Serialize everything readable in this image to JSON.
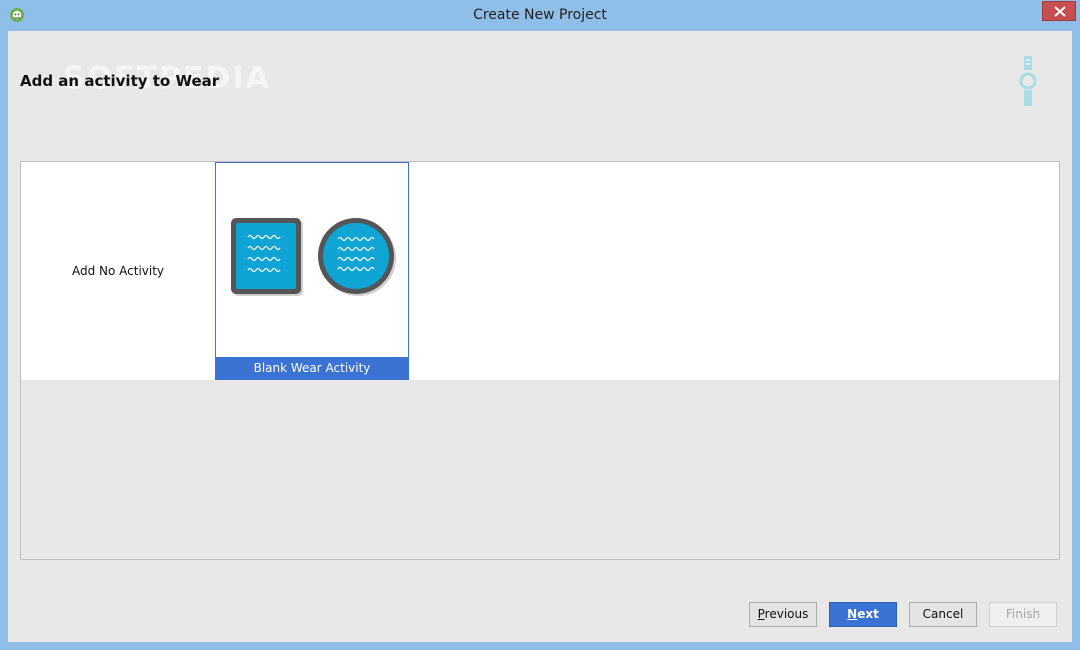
{
  "window": {
    "title": "Create New Project",
    "icon": "android-studio-icon",
    "close_icon": "close-icon"
  },
  "header": {
    "title": "Add an activity to Wear",
    "watermark": "SOFTPEDIA",
    "logo_icon": "wear-watch-icon"
  },
  "gallery": {
    "tiles": [
      {
        "label": "Add No Activity",
        "selected": false
      },
      {
        "label": "Blank Wear Activity",
        "selected": true,
        "preview_icon": "wear-square-and-round-preview-icon"
      }
    ]
  },
  "buttons": {
    "previous": "Previous",
    "previous_mnemonic": "P",
    "previous_rest": "revious",
    "next": "Next",
    "next_mnemonic": "N",
    "next_rest": "ext",
    "cancel": "Cancel",
    "finish": "Finish"
  },
  "colors": {
    "accent": "#3a73d4",
    "wear_teal": "#0ea5d4",
    "frame_gray": "#555555",
    "titlebar": "#8fbfe8",
    "close_red": "#c74f4f"
  }
}
